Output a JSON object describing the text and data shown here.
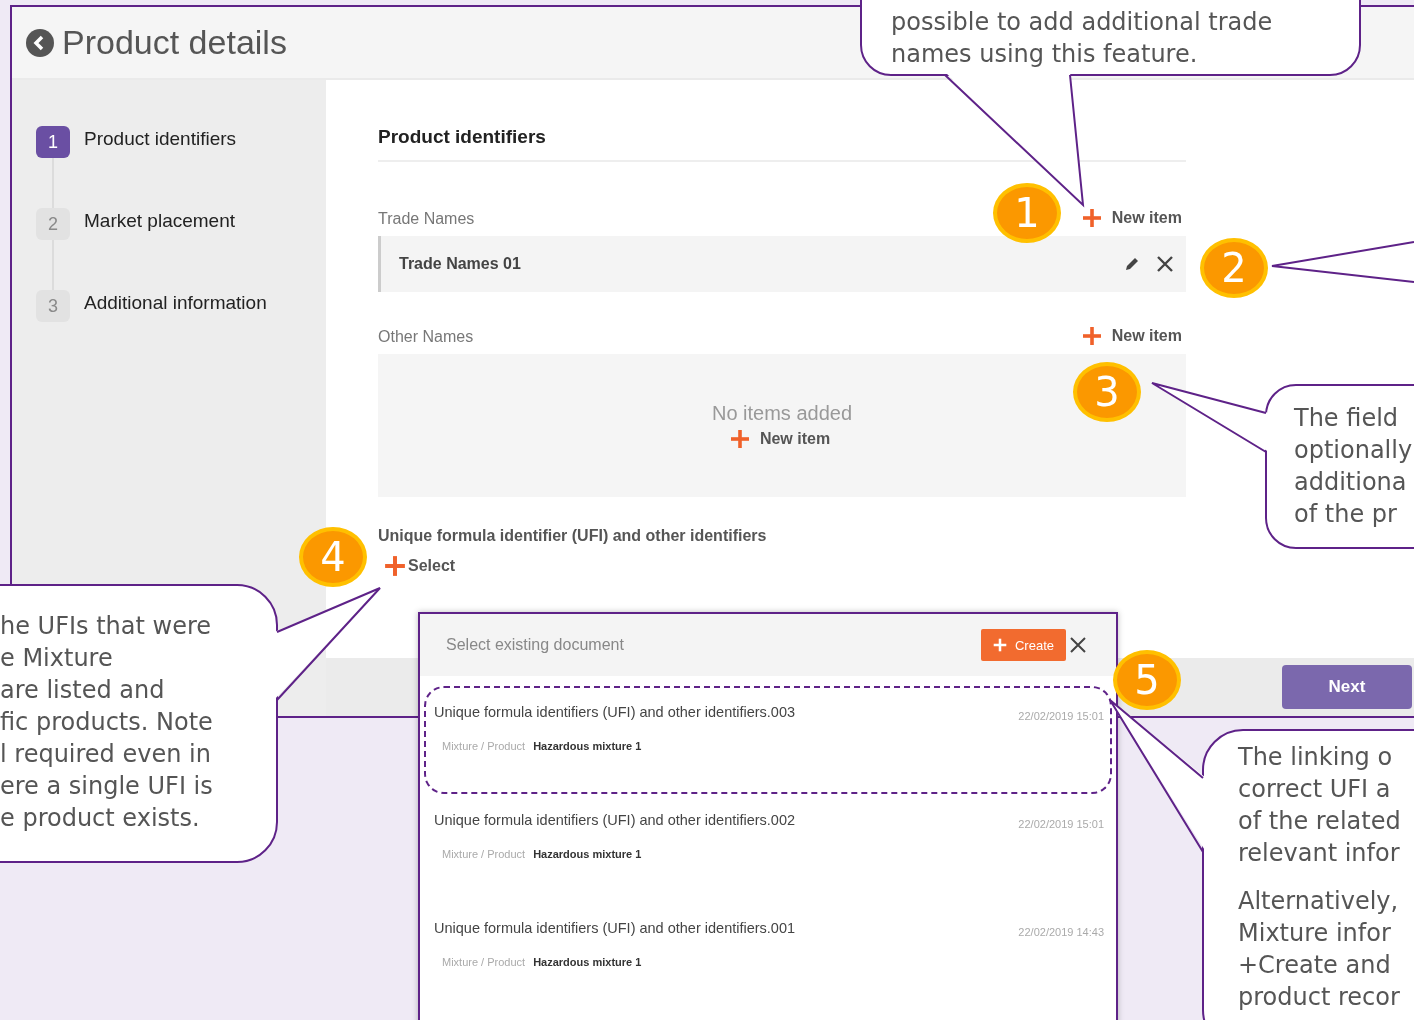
{
  "header": {
    "title": "Product details"
  },
  "steps": [
    {
      "number": "1",
      "label": "Product identifiers",
      "selected": true
    },
    {
      "number": "2",
      "label": "Market placement",
      "selected": false
    },
    {
      "number": "3",
      "label": "Additional information",
      "selected": false
    }
  ],
  "section": {
    "title": "Product identifiers"
  },
  "trade_names": {
    "label": "Trade Names",
    "action": "New item",
    "items": [
      "Trade Names 01"
    ]
  },
  "other_names": {
    "label": "Other Names",
    "action": "New item",
    "empty_text": "No items added",
    "empty_action": "New item"
  },
  "ufi": {
    "label": "Unique formula identifier (UFI) and other identifiers",
    "action": "Select"
  },
  "footer": {
    "next": "Next"
  },
  "dialog": {
    "title": "Select existing document",
    "create": "Create",
    "rows": [
      {
        "title": "Unique formula identifiers (UFI) and other identifiers.003",
        "date": "22/02/2019 15:01",
        "type": "Mixture / Product",
        "product": "Hazardous mixture 1",
        "highlighted": true
      },
      {
        "title": "Unique formula identifiers (UFI) and other identifiers.002",
        "date": "22/02/2019 15:01",
        "type": "Mixture / Product",
        "product": "Hazardous mixture 1",
        "highlighted": false
      },
      {
        "title": "Unique formula identifiers (UFI) and other identifiers.001",
        "date": "22/02/2019 14:43",
        "type": "Mixture / Product",
        "product": "Hazardous mixture 1",
        "highlighted": false
      }
    ]
  },
  "badges": [
    "1",
    "2",
    "3",
    "4",
    "5"
  ],
  "callouts": [
    {
      "kind": "bubble",
      "paragraphs": [
        [
          "possible to add additional trade",
          "names using this feature."
        ]
      ]
    },
    {
      "kind": "pointer"
    },
    {
      "kind": "bubble",
      "paragraphs": [
        [
          "The field",
          "optionally",
          "additiona",
          "of the pr"
        ]
      ]
    },
    {
      "kind": "bubble",
      "paragraphs": [
        [
          "he UFIs that were",
          "e Mixture",
          "are listed and",
          "fic products. Note",
          "l required even in",
          "ere a single UFI is",
          "e product exists."
        ]
      ]
    },
    {
      "kind": "bubble",
      "paragraphs": [
        [
          "The linking o",
          "correct UFI a",
          "of the related",
          "relevant infor"
        ],
        [
          "Alternatively,",
          "Mixture infor",
          "+Create and",
          "product recor"
        ]
      ]
    }
  ]
}
